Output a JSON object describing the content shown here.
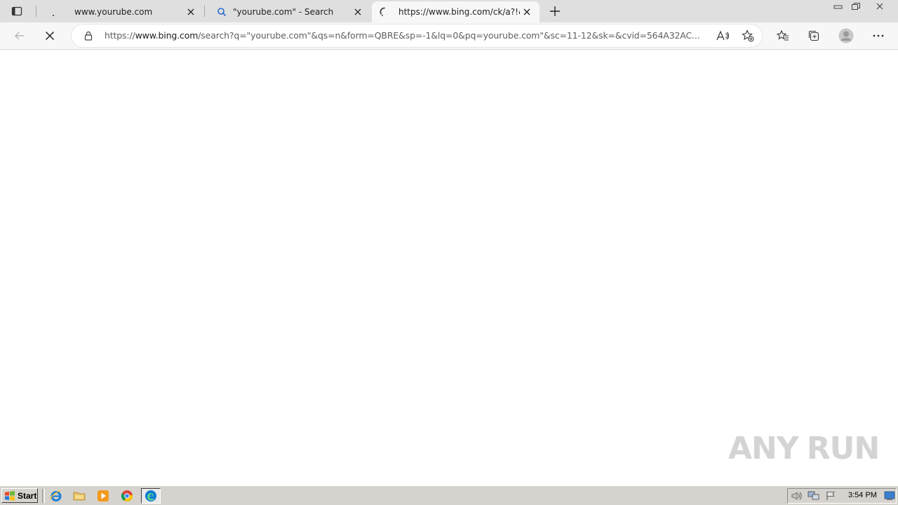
{
  "tabs": [
    {
      "title": "www.yourube.com",
      "favicon": "dot",
      "active": false
    },
    {
      "title": "\"yourube.com\" - Search",
      "favicon": "search-icon",
      "active": false
    },
    {
      "title": "https://www.bing.com/ck/a?!&",
      "favicon": "loading-spinner-icon",
      "active": true
    }
  ],
  "address_bar": {
    "url_prefix": "https://",
    "url_host": "www.bing.com",
    "url_path": "/search?q=\"yourube.com\"&qs=n&form=QBRE&sp=-1&lq=0&pq=yourube.com\"&sc=11-12&sk=&cvid=564A32AC..."
  },
  "watermark": {
    "left": "ANY",
    "right": "RUN"
  },
  "taskbar": {
    "start_label": "Start",
    "clock": "3:54 PM"
  },
  "colors": {
    "tabstrip": "#dfdfdf",
    "toolbar": "#f7f7f7",
    "taskbar": "#d6d3ce",
    "edge_accent": "#0c7ad6"
  }
}
